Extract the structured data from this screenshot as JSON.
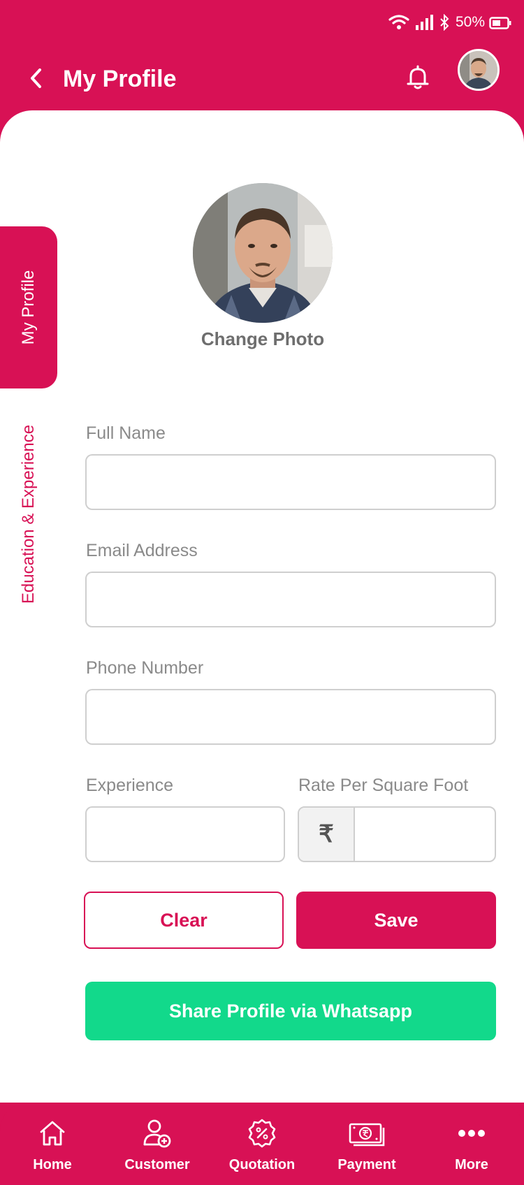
{
  "status_bar": {
    "battery": "50%"
  },
  "header": {
    "title": "My Profile"
  },
  "side_tabs": [
    {
      "label": "My Profile",
      "active": true
    },
    {
      "label": "Education & Experience",
      "active": false
    }
  ],
  "profile": {
    "change_photo": "Change Photo"
  },
  "form": {
    "full_name": {
      "label": "Full Name",
      "value": ""
    },
    "email": {
      "label": "Email Address",
      "value": ""
    },
    "phone": {
      "label": "Phone Number",
      "value": ""
    },
    "experience": {
      "label": "Experience",
      "value": ""
    },
    "rate": {
      "label": "Rate Per Square Foot",
      "currency_symbol": "₹",
      "value": ""
    }
  },
  "actions": {
    "clear": "Clear",
    "save": "Save",
    "share": "Share Profile via Whatsapp"
  },
  "bottom_nav": [
    {
      "label": "Home",
      "icon": "home-icon"
    },
    {
      "label": "Customer",
      "icon": "add-customer-icon"
    },
    {
      "label": "Quotation",
      "icon": "quotation-icon"
    },
    {
      "label": "Payment",
      "icon": "payment-icon"
    },
    {
      "label": "More",
      "icon": "more-icon"
    }
  ],
  "colors": {
    "primary": "#d81155",
    "whatsapp": "#12d98b",
    "label_gray": "#8a8a8a"
  }
}
